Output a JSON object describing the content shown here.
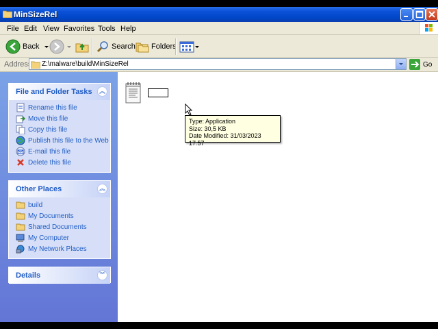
{
  "window": {
    "title": "MinSizeRel"
  },
  "menu": [
    "File",
    "Edit",
    "View",
    "Favorites",
    "Tools",
    "Help"
  ],
  "toolbar": {
    "back_label": "Back",
    "search_label": "Search",
    "folders_label": "Folders"
  },
  "address": {
    "label": "Address",
    "value": "Z:\\malware\\build\\MinSizeRel",
    "go_label": "Go"
  },
  "file_tasks": {
    "title": "File and Folder Tasks",
    "items": [
      {
        "label": "Rename this file",
        "icon": "rename-icon"
      },
      {
        "label": "Move this file",
        "icon": "move-icon"
      },
      {
        "label": "Copy this file",
        "icon": "copy-icon"
      },
      {
        "label": "Publish this file to the Web",
        "icon": "globe-icon"
      },
      {
        "label": "E-mail this file",
        "icon": "email-icon"
      },
      {
        "label": "Delete this file",
        "icon": "delete-icon"
      }
    ]
  },
  "other_places": {
    "title": "Other Places",
    "items": [
      {
        "label": "build",
        "icon": "folder-icon"
      },
      {
        "label": "My Documents",
        "icon": "folder-icon"
      },
      {
        "label": "Shared Documents",
        "icon": "folder-icon"
      },
      {
        "label": "My Computer",
        "icon": "computer-icon"
      },
      {
        "label": "My Network Places",
        "icon": "network-icon"
      }
    ]
  },
  "details": {
    "title": "Details"
  },
  "tooltip": {
    "line1": "Type: Application",
    "line2": "Size: 30,5 KB",
    "line3": "Date Modified: 31/03/2023 17:57"
  },
  "colors": {
    "accent": "#215dc6",
    "titlebar": "#0a51d8",
    "pane": "#6375d6"
  }
}
